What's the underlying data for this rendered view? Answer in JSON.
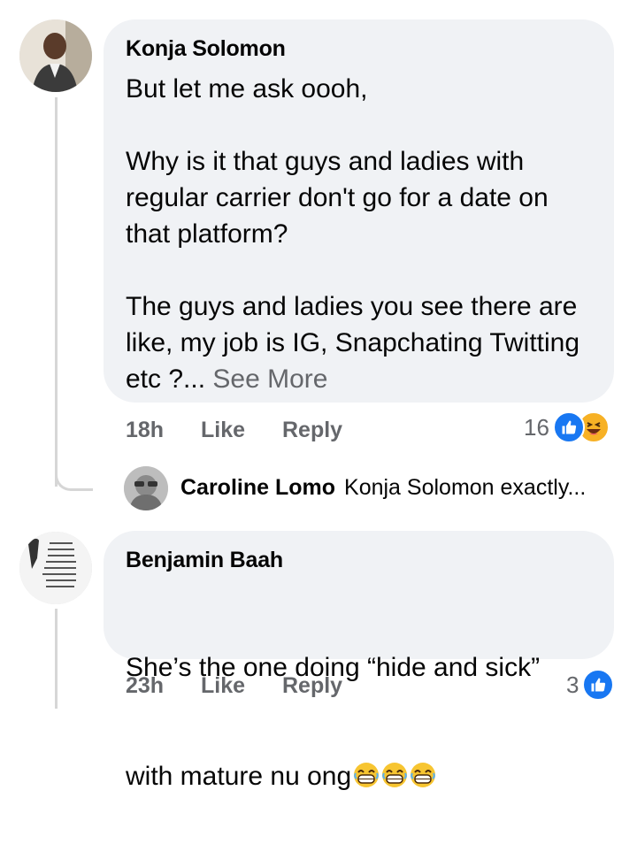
{
  "comments": [
    {
      "author": "Konja Solomon",
      "text": "But let me ask oooh,\n\nWhy is it that guys and ladies with regular carrier don't go for a date on that platform?\n\nThe guys and ladies you see there are like, my job is IG, Snapchating Twitting etc ?...",
      "see_more": "See More",
      "time": "18h",
      "like": "Like",
      "reply": "Reply",
      "reaction_count": "16",
      "reactions": [
        "like-icon",
        "haha-icon"
      ]
    },
    {
      "author": "Benjamin Baah",
      "text_line1": "She’s the one doing “hide and sick”",
      "text_line2": "with mature nu ong",
      "time": "23h",
      "like": "Like",
      "reply": "Reply",
      "reaction_count": "3",
      "reactions": [
        "like-icon"
      ]
    }
  ],
  "reply_preview": {
    "author": "Caroline Lomo",
    "text": "Konja Solomon exactly..."
  },
  "colors": {
    "bubble": "#f0f2f5",
    "meta": "#65676b",
    "like_blue": "#1877f2",
    "haha_yellow": "#f7b125"
  }
}
